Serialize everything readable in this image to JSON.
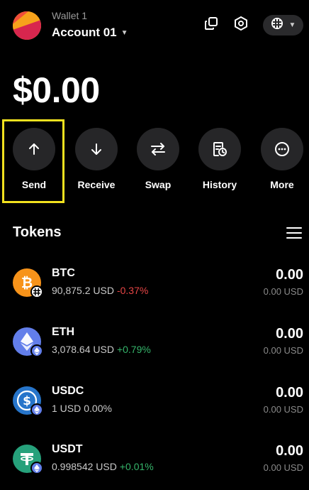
{
  "header": {
    "wallet_name": "Wallet 1",
    "account_name": "Account 01",
    "icons": [
      "copy-icon",
      "settings-icon",
      "network-icon"
    ]
  },
  "balance": "$0.00",
  "actions": [
    {
      "label": "Send",
      "icon": "arrow-up-icon"
    },
    {
      "label": "Receive",
      "icon": "arrow-down-icon"
    },
    {
      "label": "Swap",
      "icon": "swap-icon"
    },
    {
      "label": "History",
      "icon": "history-icon"
    },
    {
      "label": "More",
      "icon": "more-icon"
    }
  ],
  "tokens": {
    "title": "Tokens",
    "items": [
      {
        "symbol": "BTC",
        "price": "90,875.2 USD",
        "change": "-0.37%",
        "amount": "0.00",
        "value": "0.00 USD",
        "color": "#f7931a"
      },
      {
        "symbol": "ETH",
        "price": "3,078.64 USD",
        "change": "+0.79%",
        "amount": "0.00",
        "value": "0.00 USD",
        "color": "#627eea"
      },
      {
        "symbol": "USDC",
        "price": "1 USD",
        "change": "0.00%",
        "amount": "0.00",
        "value": "0.00 USD",
        "color": "#2775ca"
      },
      {
        "symbol": "USDT",
        "price": "0.998542 USD",
        "change": "+0.01%",
        "amount": "0.00",
        "value": "0.00 USD",
        "color": "#26a17b"
      }
    ]
  },
  "colors": {
    "background": "#000000",
    "highlight": "#f2e11f",
    "negative": "#e64545",
    "positive": "#35b46a"
  }
}
